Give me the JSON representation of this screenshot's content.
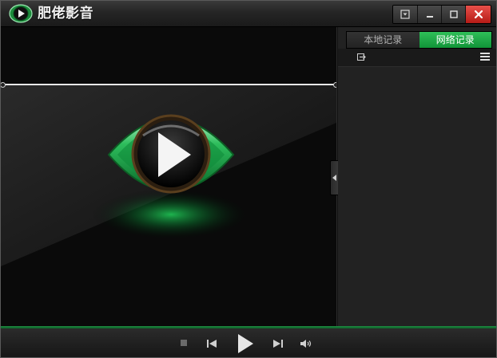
{
  "app": {
    "title": "肥佬影音"
  },
  "window_controls": [
    "menu-icon",
    "minimize-icon",
    "restore-icon",
    "close-icon"
  ],
  "playlist": {
    "tabs": [
      {
        "label": "本地记录",
        "active": false
      },
      {
        "label": "网络记录",
        "active": true
      }
    ],
    "toolbar_icons": [
      "import-icon",
      "list-menu-icon"
    ]
  },
  "controls": [
    "stop-icon",
    "previous-icon",
    "play-icon",
    "next-icon",
    "volume-icon"
  ],
  "colors": {
    "accent": "#19a845",
    "close": "#d32f2a",
    "background": "#111111"
  }
}
